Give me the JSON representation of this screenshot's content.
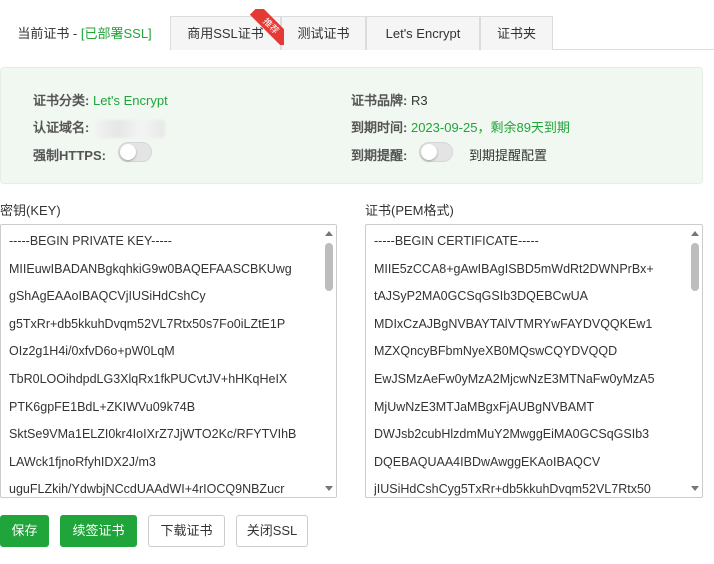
{
  "tabs": [
    {
      "label": "当前证书 - ",
      "status": "[已部署SSL]"
    },
    {
      "label": "商用SSL证书",
      "ribbon": "推荐"
    },
    {
      "label": "测试证书"
    },
    {
      "label": "Let's Encrypt"
    },
    {
      "label": "证书夹"
    }
  ],
  "info": {
    "category_label": "证书分类:",
    "category_value": "Let's Encrypt",
    "domain_label": "认证域名:",
    "https_label": "强制HTTPS:",
    "brand_label": "证书品牌:",
    "brand_value": "R3",
    "expiry_label": "到期时间:",
    "expiry_value": "2023-09-25，剩余89天到期",
    "reminder_label": "到期提醒:",
    "reminder_config_link": "到期提醒配置"
  },
  "key": {
    "label": "密钥(KEY)",
    "lines": [
      "-----BEGIN PRIVATE KEY-----",
      "MIIEuwIBADANBgkqhkiG9w0BAQEFAASCBKUwg",
      "gShAgEAAoIBAQCVjIUSiHdCshCy",
      "g5TxRr+db5kkuhDvqm52VL7Rtx50s7Fo0iLZtE1P",
      "OIz2g1H4i/0xfvD6o+pW0LqM",
      "TbR0LOOihdpdLG3XlqRx1fkPUCvtJV+hHKqHeIX",
      "PTK6gpFE1BdL+ZKIWVu09k74B",
      "SktSe9VMa1ELZI0kr4IoIXrZ7JjWTO2Kc/RFYTVIhB",
      "LAWck1fjnoRfyhIDX2J/m3",
      "uguFLZkih/YdwbjNCcdUAAdWI+4rIOCQ9NBZucr"
    ]
  },
  "cert": {
    "label": "证书(PEM格式)",
    "lines": [
      "-----BEGIN CERTIFICATE-----",
      "MIIE5zCCA8+gAwIBAgISBD5mWdRt2DWNPrBx+",
      "tAJSyP2MA0GCSqGSIb3DQEBCwUA",
      "MDIxCzAJBgNVBAYTAlVTMRYwFAYDVQQKEw1",
      "MZXQncyBFbmNyeXB0MQswCQYDVQQD",
      "EwJSMzAeFw0yMzA2MjcwNzE3MTNaFw0yMzA5",
      "MjUwNzE3MTJaMBgxFjAUBgNVBAMT",
      "DWJsb2cubHlzdmMuY2MwggEiMA0GCSqGSIb3",
      "DQEBAQUAA4IBDwAwggEKAoIBAQCV",
      "jIUSiHdCshCyg5TxRr+db5kkuhDvqm52VL7Rtx50"
    ]
  },
  "buttons": {
    "save": "保存",
    "renew": "续签证书",
    "download": "下载证书",
    "close_ssl": "关闭SSL"
  },
  "colors": {
    "accent": "#20a53a",
    "panel_bg": "#f0f8f1",
    "ribbon": "#e53935"
  }
}
